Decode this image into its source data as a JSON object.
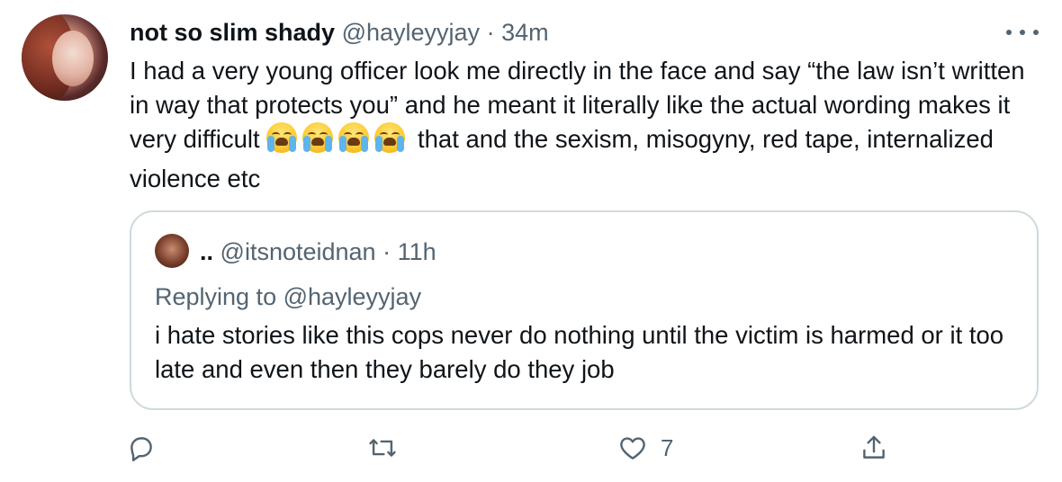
{
  "author": {
    "display_name": "not so slim shady",
    "handle": "@hayleyyjay",
    "separator": "·",
    "time": "34m"
  },
  "tweet": {
    "text_before_emoji": "I had a very young officer look me directly in the face and say “the law isn’t written in way that protects you” and he meant it literally like the actual wording makes it very difficult ",
    "emoji": [
      "loudly-crying-face",
      "loudly-crying-face",
      "loudly-crying-face",
      "loudly-crying-face"
    ],
    "text_after_emoji": " that and the sexism, misogyny, red tape, internalized violence etc"
  },
  "quoted": {
    "display_name": "..",
    "handle": "@itsnoteidnan",
    "separator": "·",
    "time": "11h",
    "replying_prefix": "Replying to ",
    "replying_handle": "@hayleyyjay",
    "text": "i hate stories like this cops never do nothing until the victim is harmed or it too late and even then they barely do they job"
  },
  "actions": {
    "reply_icon": "speech-bubble-icon",
    "retweet_icon": "retweet-icon",
    "like_icon": "heart-icon",
    "like_count": "7",
    "share_icon": "share-upload-icon"
  },
  "colors": {
    "text": "#0f1419",
    "secondary": "#536471",
    "border": "#cfd9de"
  }
}
